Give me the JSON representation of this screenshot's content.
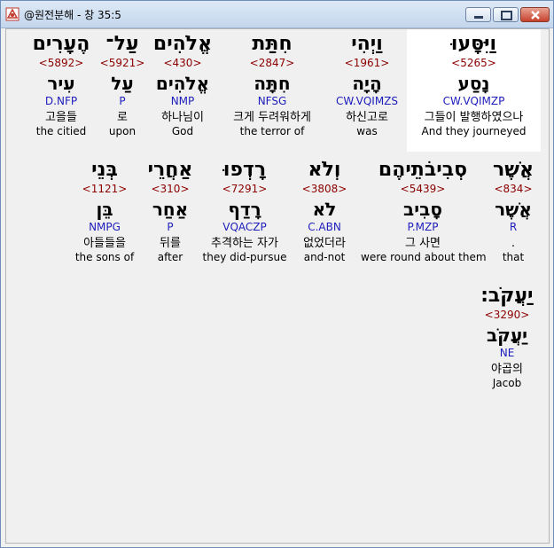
{
  "window": {
    "title": "@원전분해 - 창 35:5"
  },
  "colors": {
    "strong": "#8b0000",
    "morph": "#1d1dbb",
    "highlight": "#ffffff"
  },
  "rows": [
    {
      "words": [
        {
          "hebrew": "וַיִּסָּעוּ",
          "strong": "<5265>",
          "lemma": "נָסַע",
          "morph": "CW.VQIMZP",
          "korean": "그들이 발행하였으나",
          "english": "And they journeyed"
        },
        {
          "hebrew": "וַיְהִי",
          "strong": "<1961>",
          "lemma": "הָיָה",
          "morph": "CW.VQIMZS",
          "korean": "하신고로",
          "english": "was"
        },
        {
          "hebrew": "חִתַּת",
          "strong": "<2847>",
          "lemma": "חִתָּה",
          "morph": "NFSG",
          "korean": "크게 두려워하게",
          "english": "the terror of"
        },
        {
          "hebrew": "אֱלֹהִים",
          "strong": "<430>",
          "lemma": "אֱלֹהִים",
          "morph": "NMP",
          "korean": "하나님이",
          "english": "God"
        },
        {
          "hebrew": "עַל־",
          "strong": "<5921>",
          "lemma": "עַל",
          "morph": "P",
          "korean": "로",
          "english": "upon"
        },
        {
          "hebrew": "הֶעָרִים",
          "strong": "<5892>",
          "lemma": "עִיר",
          "morph": "D.NFP",
          "korean": "고을들",
          "english": "the citied"
        }
      ]
    },
    {
      "words": [
        {
          "hebrew": "אֲשֶׁר",
          "strong": "<834>",
          "lemma": "אֲשֶׁר",
          "morph": "R",
          "korean": ".",
          "english": "that"
        },
        {
          "hebrew": "סְבִיבֹתֵיהֶם",
          "strong": "<5439>",
          "lemma": "סָבִיב",
          "morph": "P.MZP",
          "korean": "그 사면",
          "english": "were round about them"
        },
        {
          "hebrew": "וְלֹא",
          "strong": "<3808>",
          "lemma": "לֹא",
          "morph": "C.ABN",
          "korean": "없었더라",
          "english": "and-not"
        },
        {
          "hebrew": "רָדְפוּ",
          "strong": "<7291>",
          "lemma": "רָדַף",
          "morph": "VQACZP",
          "korean": "추격하는 자가",
          "english": "they did-pursue"
        },
        {
          "hebrew": "אַחֲרֵי",
          "strong": "<310>",
          "lemma": "אַחַר",
          "morph": "P",
          "korean": "뒤를",
          "english": "after"
        },
        {
          "hebrew": "בְּנֵי",
          "strong": "<1121>",
          "lemma": "בֵּן",
          "morph": "NMPG",
          "korean": "아들들을",
          "english": "the sons of"
        }
      ]
    },
    {
      "words": [
        {
          "hebrew": "יַעֲקֹב׃",
          "strong": "<3290>",
          "lemma": "יַעֲקֹב",
          "morph": "NE",
          "korean": "야곱의",
          "english": "Jacob"
        }
      ]
    }
  ]
}
